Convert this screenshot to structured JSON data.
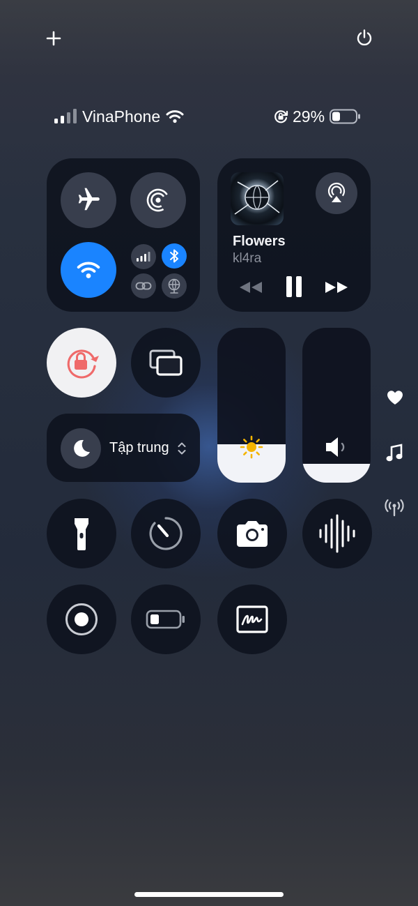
{
  "status_bar": {
    "carrier": "VinaPhone",
    "battery_percent": "29%",
    "battery_level": 0.29
  },
  "connectivity": {
    "airplane_mode": false,
    "airdrop": false,
    "wifi": true,
    "cellular": false,
    "bluetooth": true
  },
  "now_playing": {
    "title": "Flowers",
    "artist": "kl4ra"
  },
  "focus": {
    "label": "Tập trung"
  },
  "brightness": {
    "level": 0.25
  },
  "volume": {
    "level": 0.12
  },
  "colors": {
    "active_blue": "#1a84ff",
    "panel": "#0e121e",
    "orientation_lock_red": "#ef6a6a"
  },
  "icons": {
    "top_left": "plus-icon",
    "top_right": "power-icon",
    "side": [
      "heart-icon",
      "music-note-icon",
      "antenna-icon"
    ]
  }
}
